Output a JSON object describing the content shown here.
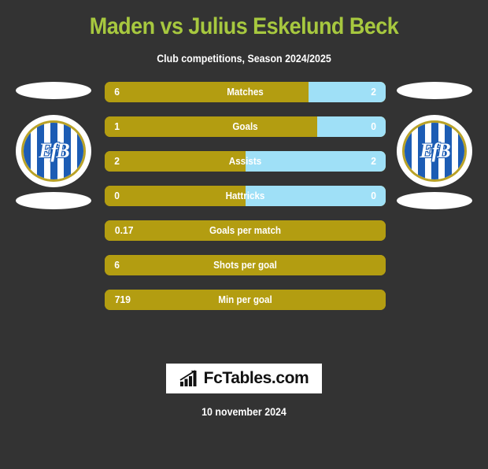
{
  "header": {
    "title": "Maden vs Julius Eskelund Beck",
    "subtitle": "Club competitions, Season 2024/2025",
    "title_color": "#a7c83f"
  },
  "theme": {
    "background": "#333333",
    "home_color": "#b39d11",
    "away_color": "#9fe0f7",
    "text_color": "#ffffff"
  },
  "crests": {
    "left": {
      "name": "Esbjerg fB",
      "monogram": "EfB"
    },
    "right": {
      "name": "Esbjerg fB",
      "monogram": "EfB"
    }
  },
  "stats": [
    {
      "label": "Matches",
      "home": "6",
      "away": "2",
      "home_pct": 72.5,
      "split": true
    },
    {
      "label": "Goals",
      "home": "1",
      "away": "0",
      "home_pct": 75.5,
      "split": true
    },
    {
      "label": "Assists",
      "home": "2",
      "away": "2",
      "home_pct": 50.0,
      "split": true
    },
    {
      "label": "Hattricks",
      "home": "0",
      "away": "0",
      "home_pct": 50.0,
      "split": true
    },
    {
      "label": "Goals per match",
      "home": "0.17",
      "away": "",
      "home_pct": 100,
      "split": false
    },
    {
      "label": "Shots per goal",
      "home": "6",
      "away": "",
      "home_pct": 100,
      "split": false
    },
    {
      "label": "Min per goal",
      "home": "719",
      "away": "",
      "home_pct": 100,
      "split": false
    }
  ],
  "footer": {
    "logo_text": "FcTables.com",
    "logo_icon": "bar-chart-growth-icon",
    "date": "10 november 2024"
  }
}
